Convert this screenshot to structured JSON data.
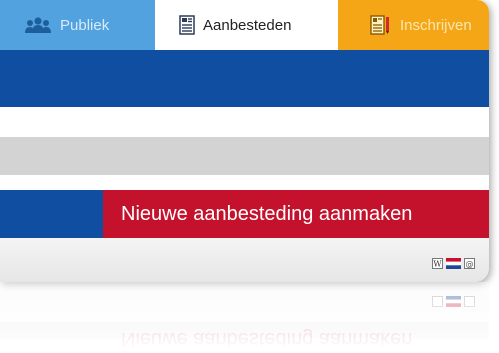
{
  "tabs": [
    {
      "label": "Publiek",
      "icon": "people-icon"
    },
    {
      "label": "Aanbesteden",
      "icon": "document-icon"
    },
    {
      "label": "Inschrijven",
      "icon": "document-pen-icon"
    }
  ],
  "action": {
    "label": "Nieuwe aanbesteding aanmaken"
  },
  "toolbar": {
    "icons": [
      "wikipedia-icon",
      "dutch-flag-icon",
      "email-icon"
    ]
  },
  "colors": {
    "publiek_tab": "#52a2e0",
    "inschrijven_tab": "#f5a616",
    "primary_blue": "#0f4ea0",
    "action_red": "#c4122d",
    "gray_strip": "#d3d3d3"
  }
}
